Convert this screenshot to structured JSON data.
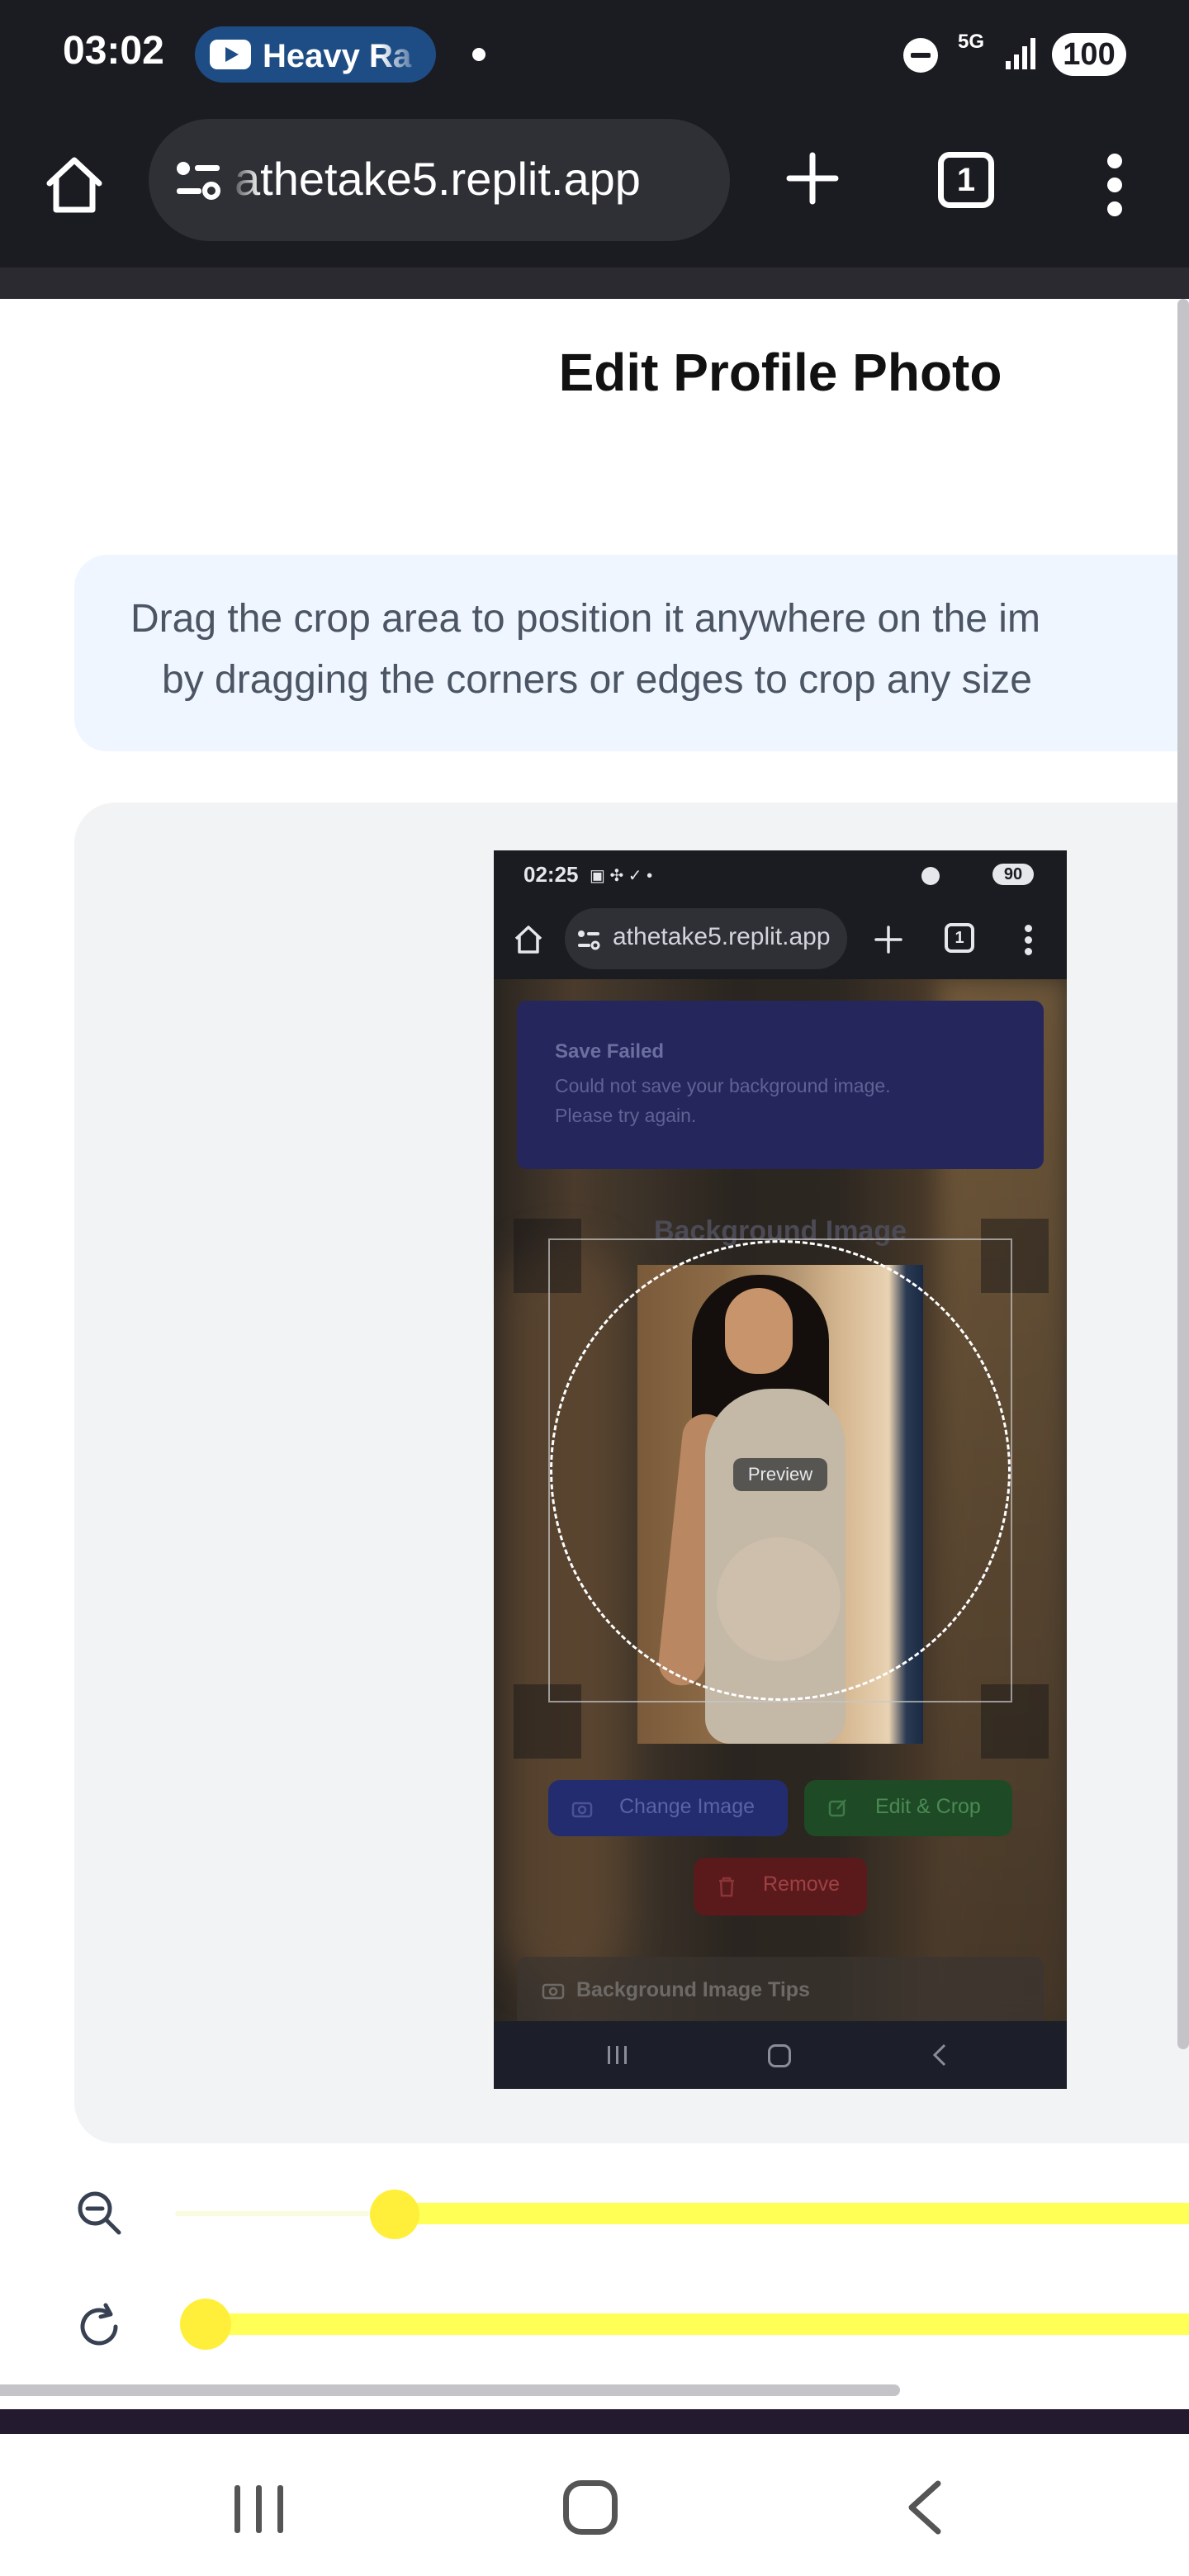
{
  "status_bar": {
    "time": "03:02",
    "media_text": "Heavy Ra",
    "network": "5G",
    "battery": "100"
  },
  "browser": {
    "url": "athetake5.replit.app",
    "tab_count": "1"
  },
  "page": {
    "title": "Edit Profile Photo",
    "instructions": [
      "Drag the crop area to position it anywhere on the im",
      "by dragging the corners or edges to crop any size"
    ]
  },
  "screenshot_image": {
    "status_time": "02:25",
    "battery": "90",
    "url": "athetake5.replit.app",
    "tab_count": "1",
    "toast_title": "Save Failed",
    "toast_message": [
      "Could not save your background image.",
      "Please try again."
    ],
    "section_heading": "Background Image",
    "preview_label": "Preview",
    "change_image_label": "Change Image",
    "edit_crop_label": "Edit & Crop",
    "remove_label": "Remove",
    "tips_label": "Background Image Tips"
  },
  "controls": {
    "zoom_level_fraction": 0.12,
    "rotation_level_fraction": 0.0,
    "slider_color": "#ffff55"
  },
  "icons": {
    "zoom": "zoom-out-icon",
    "rotate": "rotate-icon"
  }
}
